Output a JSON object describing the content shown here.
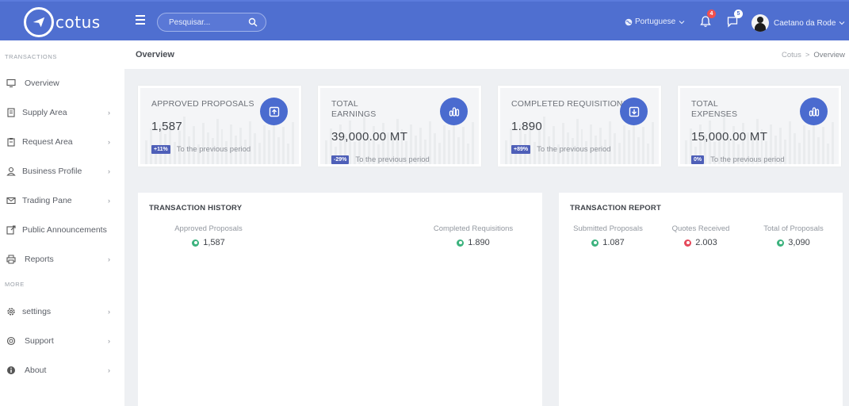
{
  "app": {
    "logo_text": "cotus"
  },
  "search": {
    "placeholder": "Pesquisar..."
  },
  "header": {
    "language": "Portuguese",
    "notifications_count": "4",
    "messages_count": "5",
    "user_name": "Caetano da Rode"
  },
  "sidebar": {
    "section_transactions": "TRANSACTIONS",
    "section_more": "MORE",
    "items": [
      {
        "label": "Overview",
        "icon": "monitor-icon",
        "arrow": ""
      },
      {
        "label": "Supply Area",
        "icon": "document-icon",
        "arrow": "›"
      },
      {
        "label": "Request Area",
        "icon": "clipboard-icon",
        "arrow": "›"
      },
      {
        "label": "Business Profile",
        "icon": "user-icon",
        "arrow": "›"
      },
      {
        "label": "Trading Pane",
        "icon": "mail-icon",
        "arrow": "›"
      },
      {
        "label": "Public Announcements",
        "icon": "external-link-icon",
        "arrow": "›"
      },
      {
        "label": "Reports",
        "icon": "printer-icon",
        "arrow": "›"
      }
    ],
    "more_items": [
      {
        "label": "settings",
        "icon": "gear-icon",
        "arrow": "›"
      },
      {
        "label": "Support",
        "icon": "support-icon",
        "arrow": "›"
      },
      {
        "label": "About",
        "icon": "info-icon",
        "arrow": "›"
      }
    ]
  },
  "page": {
    "title": "Overview",
    "breadcrumb": [
      "Cotus",
      ">",
      "Overview"
    ]
  },
  "cards": [
    {
      "label": "APPROVED PROPOSALS",
      "value": "1,587",
      "change": "+11%",
      "caption": "To the previous period",
      "icon": "upload-icon"
    },
    {
      "label": "TOTAL EARNINGS",
      "value": "39,000.00 MT",
      "change": "-29%",
      "caption": "To the previous period",
      "icon": "chart-icon"
    },
    {
      "label": "COMPLETED REQUISITIONS",
      "value": "1.890",
      "change": "+89%",
      "caption": "To the previous period",
      "icon": "download-icon"
    },
    {
      "label": "TOTAL EXPENSES",
      "value": "15,000.00 MT",
      "change": "0%",
      "caption": "To the previous period",
      "icon": "chart-icon"
    }
  ],
  "history": {
    "title": "TRANSACTION HISTORY",
    "metrics": [
      {
        "label": "Approved Proposals",
        "value": "1,587",
        "status": "up"
      },
      {
        "label": "Completed Requisitions",
        "value": "1.890",
        "status": "up"
      }
    ]
  },
  "report": {
    "title": "TRANSACTION REPORT",
    "metrics": [
      {
        "label": "Submitted Proposals",
        "value": "1.087",
        "status": "up"
      },
      {
        "label": "Quotes Received",
        "value": "2.003",
        "status": "down"
      },
      {
        "label": "Total of Proposals",
        "value": "3,090",
        "status": "up"
      }
    ]
  },
  "colors": {
    "topbar": "#4f6fd0",
    "accent": "#4a6bcf",
    "pill": "#4e5fb8",
    "up": "#3bb27d",
    "down": "#e5485a",
    "badge_red": "#f0504f"
  }
}
